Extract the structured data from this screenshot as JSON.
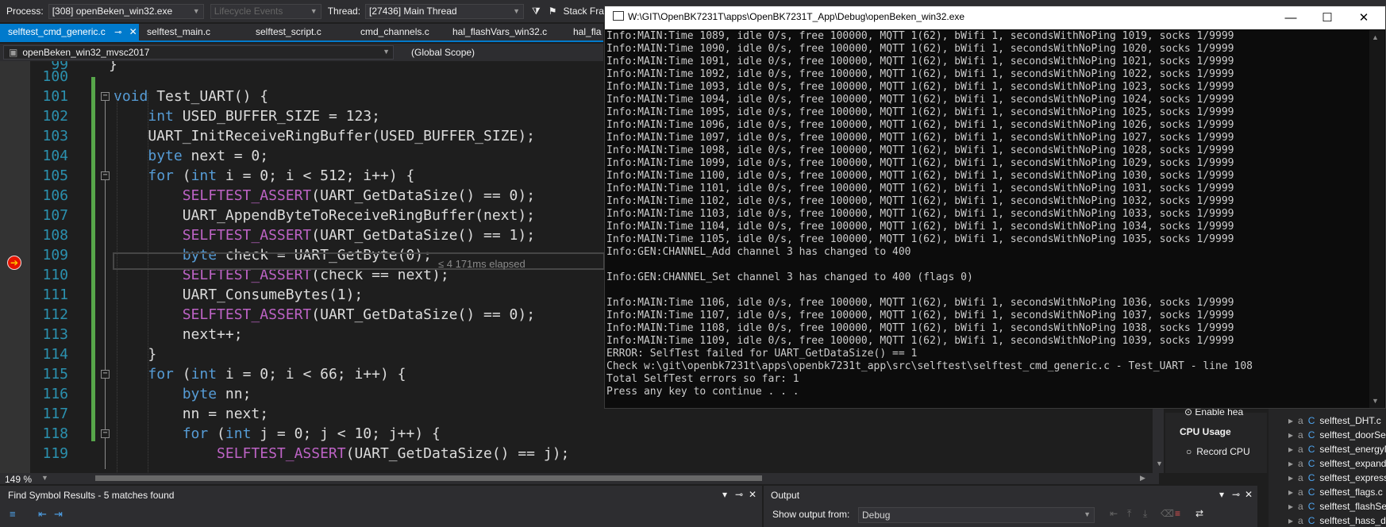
{
  "toolbar": {
    "process_label": "Process:",
    "process_value": "[308] openBeken_win32.exe",
    "lifecycle_label": "Lifecycle Events",
    "thread_label": "Thread:",
    "thread_value": "[27436] Main Thread",
    "stack_frame_label": "Stack Fra"
  },
  "tabs": [
    {
      "label": "selftest_cmd_generic.c"
    },
    {
      "label": "selftest_main.c"
    },
    {
      "label": "selftest_script.c"
    },
    {
      "label": "cmd_channels.c"
    },
    {
      "label": "hal_flashVars_win32.c"
    },
    {
      "label": "hal_fla"
    }
  ],
  "navbar": {
    "project": "openBeken_win32_mvsc2017",
    "scope": "(Global Scope)"
  },
  "editor": {
    "first_line_stub": "99",
    "zoom": "149 %",
    "elapsed": "≤ 4 171ms elapsed",
    "lines": [
      {
        "n": "100",
        "text": ""
      },
      {
        "n": "101",
        "text": "void Test_UART() {"
      },
      {
        "n": "102",
        "text": "    int USED_BUFFER_SIZE = 123;"
      },
      {
        "n": "103",
        "text": "    UART_InitReceiveRingBuffer(USED_BUFFER_SIZE);"
      },
      {
        "n": "104",
        "text": "    byte next = 0;"
      },
      {
        "n": "105",
        "text": "    for (int i = 0; i < 512; i++) {"
      },
      {
        "n": "106",
        "text": "        SELFTEST_ASSERT(UART_GetDataSize() == 0);"
      },
      {
        "n": "107",
        "text": "        UART_AppendByteToReceiveRingBuffer(next);"
      },
      {
        "n": "108",
        "text": "        SELFTEST_ASSERT(UART_GetDataSize() == 1);"
      },
      {
        "n": "109",
        "text": "        byte check = UART_GetByte(0);"
      },
      {
        "n": "110",
        "text": "        SELFTEST_ASSERT(check == next);"
      },
      {
        "n": "111",
        "text": "        UART_ConsumeBytes(1);"
      },
      {
        "n": "112",
        "text": "        SELFTEST_ASSERT(UART_GetDataSize() == 0);"
      },
      {
        "n": "113",
        "text": "        next++;"
      },
      {
        "n": "114",
        "text": "    }"
      },
      {
        "n": "115",
        "text": "    for (int i = 0; i < 66; i++) {"
      },
      {
        "n": "116",
        "text": "        byte nn;"
      },
      {
        "n": "117",
        "text": "        nn = next;"
      },
      {
        "n": "118",
        "text": "        for (int j = 0; j < 10; j++) {"
      },
      {
        "n": "119",
        "text": "            SELFTEST_ASSERT(UART_GetDataSize() == j);"
      }
    ]
  },
  "console": {
    "title": "W:\\GIT\\OpenBK7231T\\apps\\OpenBK7231T_App\\Debug\\openBeken_win32.exe",
    "lines": [
      "Info:MAIN:Time 1089, idle 0/s, free 100000, MQTT 1(62), bWifi 1, secondsWithNoPing 1019, socks 1/9999",
      "Info:MAIN:Time 1090, idle 0/s, free 100000, MQTT 1(62), bWifi 1, secondsWithNoPing 1020, socks 1/9999",
      "Info:MAIN:Time 1091, idle 0/s, free 100000, MQTT 1(62), bWifi 1, secondsWithNoPing 1021, socks 1/9999",
      "Info:MAIN:Time 1092, idle 0/s, free 100000, MQTT 1(62), bWifi 1, secondsWithNoPing 1022, socks 1/9999",
      "Info:MAIN:Time 1093, idle 0/s, free 100000, MQTT 1(62), bWifi 1, secondsWithNoPing 1023, socks 1/9999",
      "Info:MAIN:Time 1094, idle 0/s, free 100000, MQTT 1(62), bWifi 1, secondsWithNoPing 1024, socks 1/9999",
      "Info:MAIN:Time 1095, idle 0/s, free 100000, MQTT 1(62), bWifi 1, secondsWithNoPing 1025, socks 1/9999",
      "Info:MAIN:Time 1096, idle 0/s, free 100000, MQTT 1(62), bWifi 1, secondsWithNoPing 1026, socks 1/9999",
      "Info:MAIN:Time 1097, idle 0/s, free 100000, MQTT 1(62), bWifi 1, secondsWithNoPing 1027, socks 1/9999",
      "Info:MAIN:Time 1098, idle 0/s, free 100000, MQTT 1(62), bWifi 1, secondsWithNoPing 1028, socks 1/9999",
      "Info:MAIN:Time 1099, idle 0/s, free 100000, MQTT 1(62), bWifi 1, secondsWithNoPing 1029, socks 1/9999",
      "Info:MAIN:Time 1100, idle 0/s, free 100000, MQTT 1(62), bWifi 1, secondsWithNoPing 1030, socks 1/9999",
      "Info:MAIN:Time 1101, idle 0/s, free 100000, MQTT 1(62), bWifi 1, secondsWithNoPing 1031, socks 1/9999",
      "Info:MAIN:Time 1102, idle 0/s, free 100000, MQTT 1(62), bWifi 1, secondsWithNoPing 1032, socks 1/9999",
      "Info:MAIN:Time 1103, idle 0/s, free 100000, MQTT 1(62), bWifi 1, secondsWithNoPing 1033, socks 1/9999",
      "Info:MAIN:Time 1104, idle 0/s, free 100000, MQTT 1(62), bWifi 1, secondsWithNoPing 1034, socks 1/9999",
      "Info:MAIN:Time 1105, idle 0/s, free 100000, MQTT 1(62), bWifi 1, secondsWithNoPing 1035, socks 1/9999",
      "Info:GEN:CHANNEL_Add channel 3 has changed to 400",
      "",
      "Info:GEN:CHANNEL_Set channel 3 has changed to 400 (flags 0)",
      "",
      "Info:MAIN:Time 1106, idle 0/s, free 100000, MQTT 1(62), bWifi 1, secondsWithNoPing 1036, socks 1/9999",
      "Info:MAIN:Time 1107, idle 0/s, free 100000, MQTT 1(62), bWifi 1, secondsWithNoPing 1037, socks 1/9999",
      "Info:MAIN:Time 1108, idle 0/s, free 100000, MQTT 1(62), bWifi 1, secondsWithNoPing 1038, socks 1/9999",
      "Info:MAIN:Time 1109, idle 0/s, free 100000, MQTT 1(62), bWifi 1, secondsWithNoPing 1039, socks 1/9999",
      "ERROR: SelfTest failed for UART_GetDataSize() == 1",
      "Check w:\\git\\openbk7231t\\apps\\openbk7231t_app\\src\\selftest\\selftest_cmd_generic.c - Test_UART - line 108",
      "Total SelfTest errors so far: 1",
      "Press any key to continue . . ."
    ]
  },
  "bottom": {
    "find_title": "Find Symbol Results - 5 matches found",
    "output_title": "Output",
    "output_from_label": "Show output from:",
    "output_from_value": "Debug"
  },
  "diagnostics": {
    "enable_heap": "Enable hea",
    "cpu_usage_title": "CPU Usage",
    "record_cpu": "Record CPU"
  },
  "solution_items": [
    "selftest_DHT.c",
    "selftest_doorSen",
    "selftest_energyM",
    "selftest_expandC",
    "selftest_express",
    "selftest_flags.c",
    "selftest_flashSea",
    "selftest_hass_dis"
  ],
  "colors": {
    "accent": "#007acc",
    "breakpoint": "#e51400",
    "changed_margin": "#57a64a"
  }
}
